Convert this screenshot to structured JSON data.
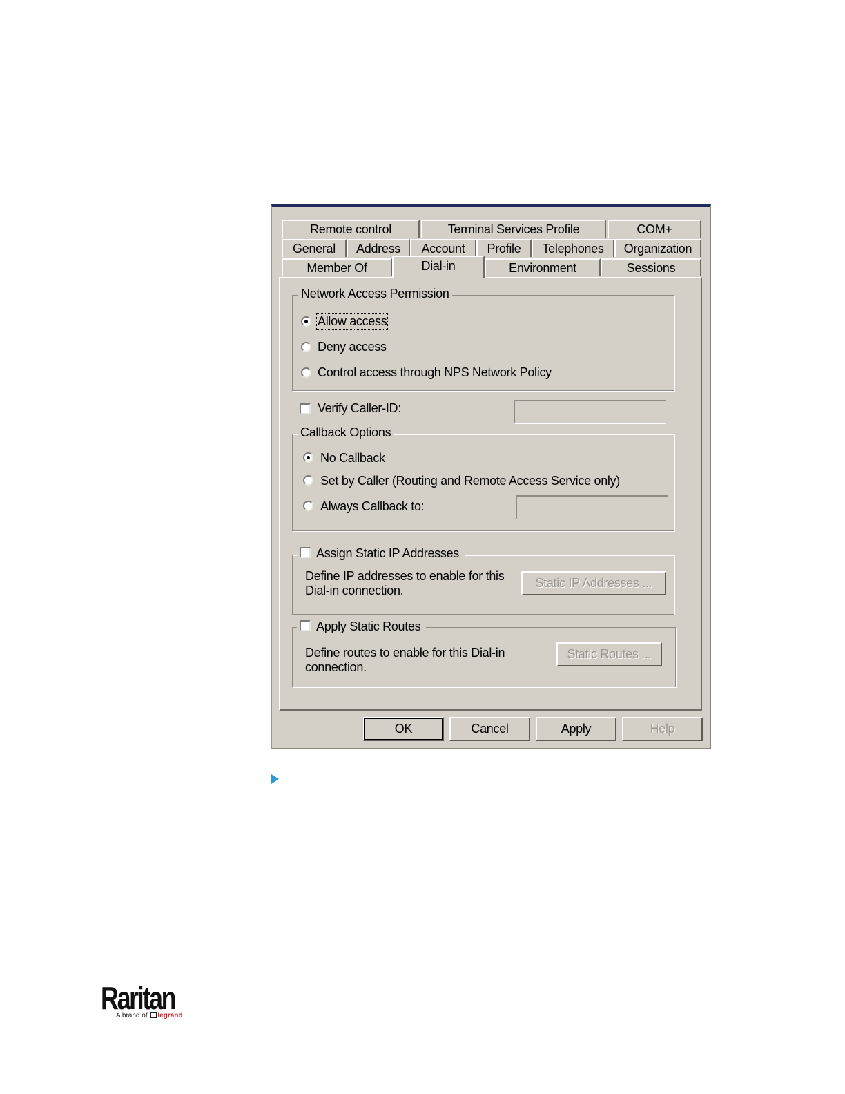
{
  "dialog": {
    "tabs_row1": [
      "Remote control",
      "Terminal Services Profile",
      "COM+"
    ],
    "tabs_row2": [
      "General",
      "Address",
      "Account",
      "Profile",
      "Telephones",
      "Organization"
    ],
    "tabs_row3": [
      "Member Of",
      "Dial-in",
      "Environment",
      "Sessions"
    ],
    "active_tab": "Dial-in",
    "network_access": {
      "legend": "Network Access Permission",
      "options": [
        "Allow access",
        "Deny access",
        "Control access through NPS Network Policy"
      ],
      "selected": "Allow access"
    },
    "verify_caller": {
      "label": "Verify Caller-ID:",
      "checked": false,
      "value": ""
    },
    "callback": {
      "legend": "Callback Options",
      "options": [
        "No Callback",
        "Set by Caller (Routing and Remote Access Service only)",
        "Always Callback to:"
      ],
      "selected": "No Callback",
      "callback_value": ""
    },
    "static_ip": {
      "label": "Assign Static IP Addresses",
      "checked": false,
      "description_line1": "Define IP addresses to enable for this",
      "description_line2": "Dial-in connection.",
      "button": "Static IP Addresses ..."
    },
    "static_routes": {
      "label": "Apply Static Routes",
      "checked": false,
      "description_line1": "Define routes to enable for this Dial-in",
      "description_line2": "connection.",
      "button": "Static Routes ..."
    },
    "buttons": {
      "ok": "OK",
      "cancel": "Cancel",
      "apply": "Apply",
      "help": "Help"
    }
  },
  "footer": {
    "logo": "Raritan",
    "tagline_prefix": "A brand of",
    "tagline_brand": "legrand"
  },
  "colors": {
    "dialog_bg": "#d4d0c8",
    "title_bar": "#1f2a5c",
    "arrow": "#2e9bd6",
    "brand_red": "#d41f2b"
  }
}
